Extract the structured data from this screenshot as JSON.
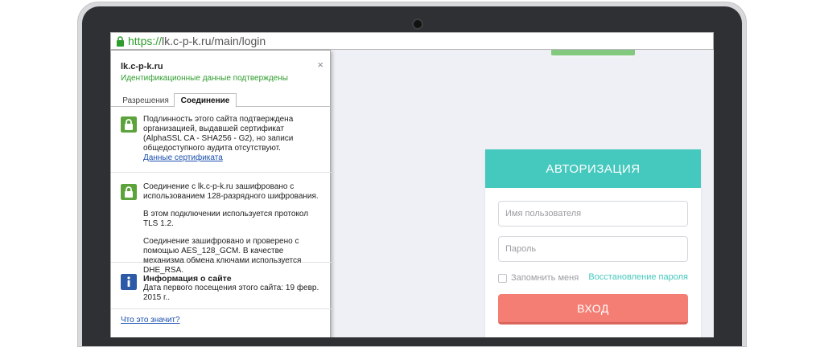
{
  "browser": {
    "url_https": "https://",
    "url_rest": "lk.c-p-k.ru/main/login"
  },
  "popup": {
    "host": "lk.c-p-k.ru",
    "verified": "Идентификационные данные подтверждены",
    "close_glyph": "×",
    "tabs": [
      "Разрешения",
      "Соединение"
    ],
    "active_tab": "Соединение",
    "identity_text": "Подлинность этого сайта подтверждена организацией, выдавшей сертификат (AlphaSSL CA - SHA256 - G2), но записи общедоступного аудита отсутствуют.",
    "certificate_link": "Данные сертификата",
    "encryption_text": "Соединение с lk.c-p-k.ru зашифровано с использованием 128-разрядного шифрования.",
    "protocol_text": "В этом подключении используется протокол TLS 1.2.",
    "cipher_text": "Соединение зашифровано и проверено с помощью AES_128_GCM. В качестве механизма обмена ключами используется DHE_RSA.",
    "info_title": "Информация о сайте",
    "info_text": "Дата первого посещения этого сайта: 19 февр. 2015 г..",
    "footer_link": "Что это значит?"
  },
  "login": {
    "header": "АВТОРИЗАЦИЯ",
    "username_placeholder": "Имя пользователя",
    "password_placeholder": "Пароль",
    "remember_label": "Запомнить меня",
    "restore_link": "Восстановление пароля",
    "submit_label": "ВХОД"
  },
  "colors": {
    "accent": "#45c8be",
    "button": "#f47e73",
    "secure_green": "#2e9d2e",
    "link_blue": "#1a4fae"
  },
  "icons": [
    "lock-icon",
    "close-icon",
    "info-icon",
    "camera"
  ]
}
